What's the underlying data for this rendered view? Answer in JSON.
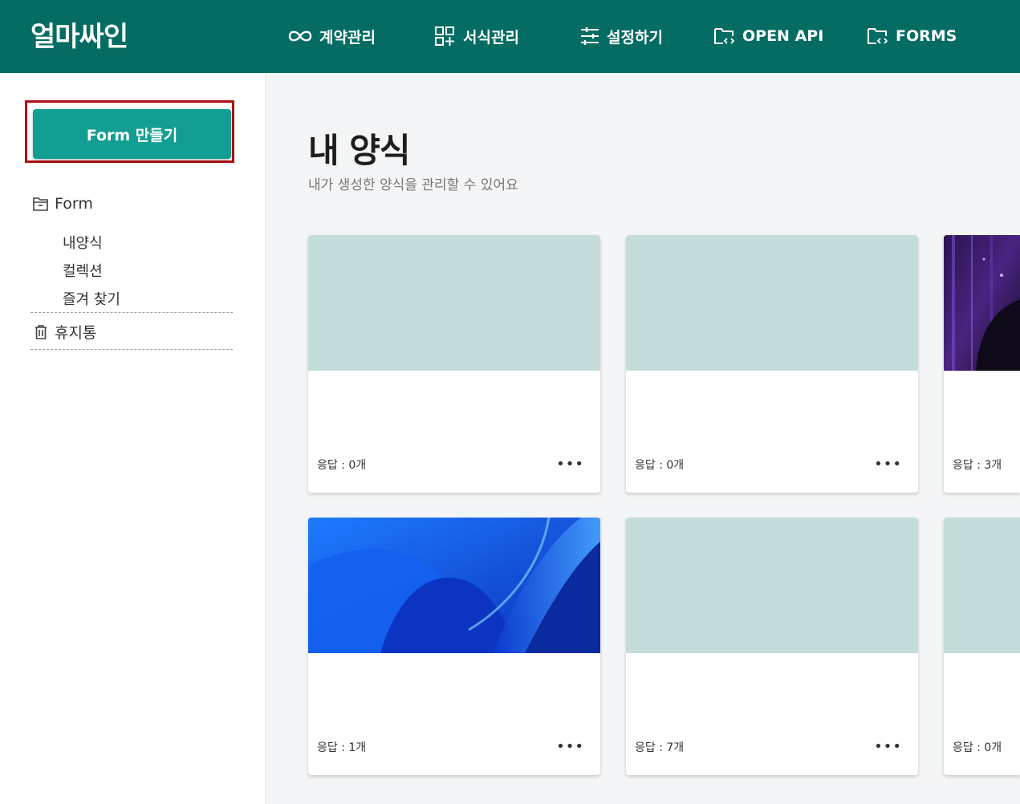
{
  "header": {
    "logo": "얼마싸인",
    "nav": [
      {
        "label": "계약관리",
        "icon": "infinity-icon"
      },
      {
        "label": "서식관리",
        "icon": "template-grid-icon"
      },
      {
        "label": "설정하기",
        "icon": "sliders-icon"
      },
      {
        "label": "OPEN API",
        "icon": "folder-code-icon"
      },
      {
        "label": "FORMS",
        "icon": "folder-code-icon"
      }
    ],
    "colors": {
      "header_bg": "#046c62",
      "accent": "#129e93",
      "highlight": "#b30d14"
    }
  },
  "sidebar": {
    "create_button": "Form 만들기",
    "form_section": "Form",
    "items": [
      "내양식",
      "컬렉션",
      "즐겨 찾기"
    ],
    "trash": "휴지통"
  },
  "main": {
    "title": "내 양식",
    "subtitle": "내가 생성한 양식을 관리할 수 있어요",
    "cards": [
      {
        "responses": "응답 : 0개",
        "thumb": "plain"
      },
      {
        "responses": "응답 : 0개",
        "thumb": "plain"
      },
      {
        "responses": "응답 : 3개",
        "thumb": "purple-image"
      },
      {
        "responses": "응답 : 1개",
        "thumb": "blue-image"
      },
      {
        "responses": "응답 : 7개",
        "thumb": "plain"
      },
      {
        "responses": "응답 : 0개",
        "thumb": "plain"
      }
    ],
    "more_label": "•••"
  }
}
